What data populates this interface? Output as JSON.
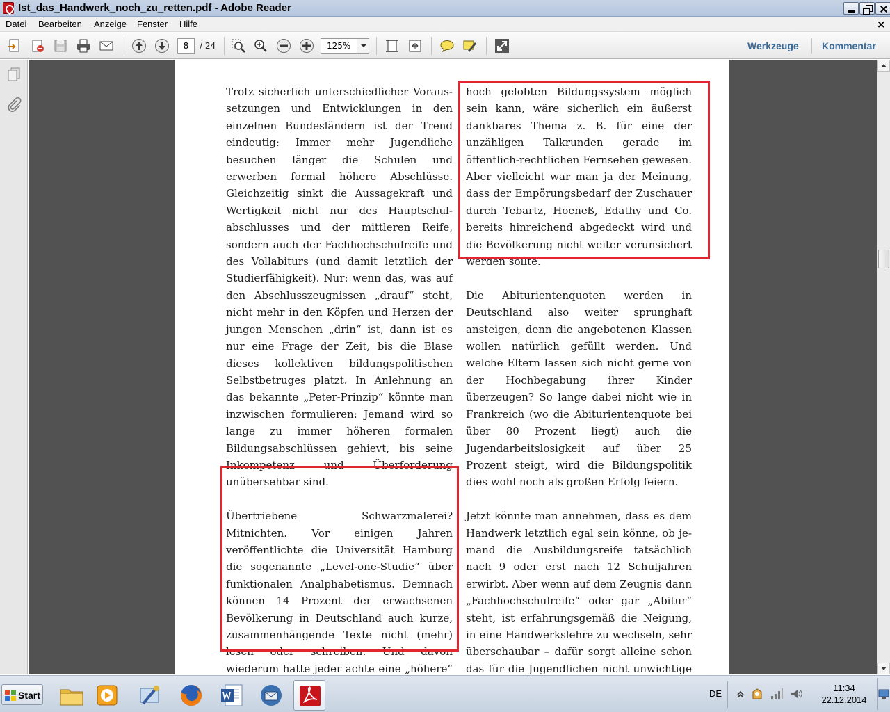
{
  "window": {
    "title": "Ist_das_Handwerk_noch_zu_retten.pdf - Adobe Reader"
  },
  "menu": {
    "items": [
      "Datei",
      "Bearbeiten",
      "Anzeige",
      "Fenster",
      "Hilfe"
    ],
    "close_glyph": "×"
  },
  "toolbar": {
    "page_current": "8",
    "page_total": "/ 24",
    "zoom": "125%",
    "tools_label": "Werkzeuge",
    "comment_label": "Kommentar"
  },
  "document": {
    "col_left_1": "Trotz sicherlich unterschiedlicher Voraus­setzungen und Entwicklungen in den einzel­nen Bundesländern ist der Trend eindeutig: Immer mehr Jugendliche besuchen länger die Schulen und erwerben formal höhere Abschlüsse. Gleichzeitig sinkt die Aussagekraft und Wertigkeit nicht nur des Hauptschul­abschlusses und der mittleren Reife, sondern auch der Fachhochschulreife und des Vollabiturs (und damit letztlich der Studierfähigkeit). Nur: wenn das, was auf den Abschlusszeugnissen „drauf“ steht, nicht mehr in den Köpfen und Herzen der jungen Menschen „drin“ ist, dann ist es nur eine Frage der Zeit, bis die Blase dieses kollektiven bil­dungspolitischen Selbstbetruges platzt. In Anlehnung an das bekannte „Peter-Prinzip“ könnte man inzwischen formulieren: Jemand wird so lange zu immer höheren formalen Bildungsabschlüssen gehievt, bis seine Inkompetenz und Überforderung unübersehbar sind.",
    "col_left_2": "Übertriebene Schwarzmalerei? Mitnichten. Vor einigen Jahren veröffentlichte die Universität Hamburg die sogenannte „Level-one-Studie“ über funktionalen Analphabe­tismus. Demnach können 14 Prozent der er­wachsenen Bevölkerung in Deutschland auch kurze, zusammenhängende Texte nicht (mehr) lesen oder schreiben. Und davon wiederum hatte jeder achte eine „höhere“ Bildung, also die Hochschulreife! Wie so etwas in unserem",
    "col_right_1": "hoch gelobten Bildungssystem möglich sein kann, wäre sicherlich ein äußerst dankbares Thema z. B. für eine der unzähligen Talkrunden gerade im öffentlich-rechtlichen Fernsehen gewesen. Aber vielleicht war man ja der Meinung, dass der Empörungsbedarf der Zuschauer durch Tebartz, Hoeneß, Edathy und Co. bereits hinreichend abgedeckt wird und die Bevölkerung nicht weiter verunsi­chert werden sollte.",
    "col_right_2": "Die Abiturientenquoten werden in Deutschland also weiter sprunghaft ansteigen, denn die angebotenen Klassen wollen natürlich ge­füllt werden. Und welche Eltern lassen sich nicht gerne von der Hochbegabung ihrer Kinder überzeugen? So lange dabei nicht wie in Frankreich (wo die Abiturientenquote bei über 80 Prozent liegt) auch die Jugendarbeits­losigkeit auf über 25 Prozent steigt, wird die Bildungspolitik dies wohl noch als großen Erfolg feiern.",
    "col_right_3": "Jetzt könnte man annehmen, dass es dem Handwerk letztlich egal sein könne, ob je­mand die Ausbildungsreife tatsächlich nach 9 oder erst nach 12 Schuljahren erwirbt. Aber wenn auf dem Zeugnis dann „Fachhochschul­reife“ oder gar „Abitur“ steht, ist erfahrungs­gemäß die Neigung, in eine Handwerkslehre zu wechseln, sehr überschaubar – dafür sorgt alleine schon das für die Jugendlichen nicht unwichtige soziale Umfeld.",
    "highlight_color": "#e3262d"
  },
  "taskbar": {
    "start_label": "Start",
    "language": "DE",
    "time": "11:34",
    "date": "22.12.2014"
  }
}
